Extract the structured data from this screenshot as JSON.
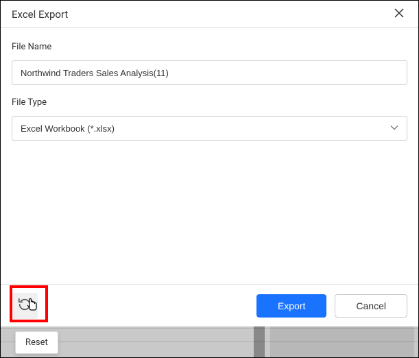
{
  "dialog": {
    "title": "Excel Export",
    "fileNameLabel": "File Name",
    "fileNameValue": "Northwind Traders Sales Analysis(11)",
    "fileTypeLabel": "File Type",
    "fileTypeValue": "Excel Workbook (*.xlsx)"
  },
  "footer": {
    "exportLabel": "Export",
    "cancelLabel": "Cancel"
  },
  "tooltip": {
    "resetLabel": "Reset"
  }
}
